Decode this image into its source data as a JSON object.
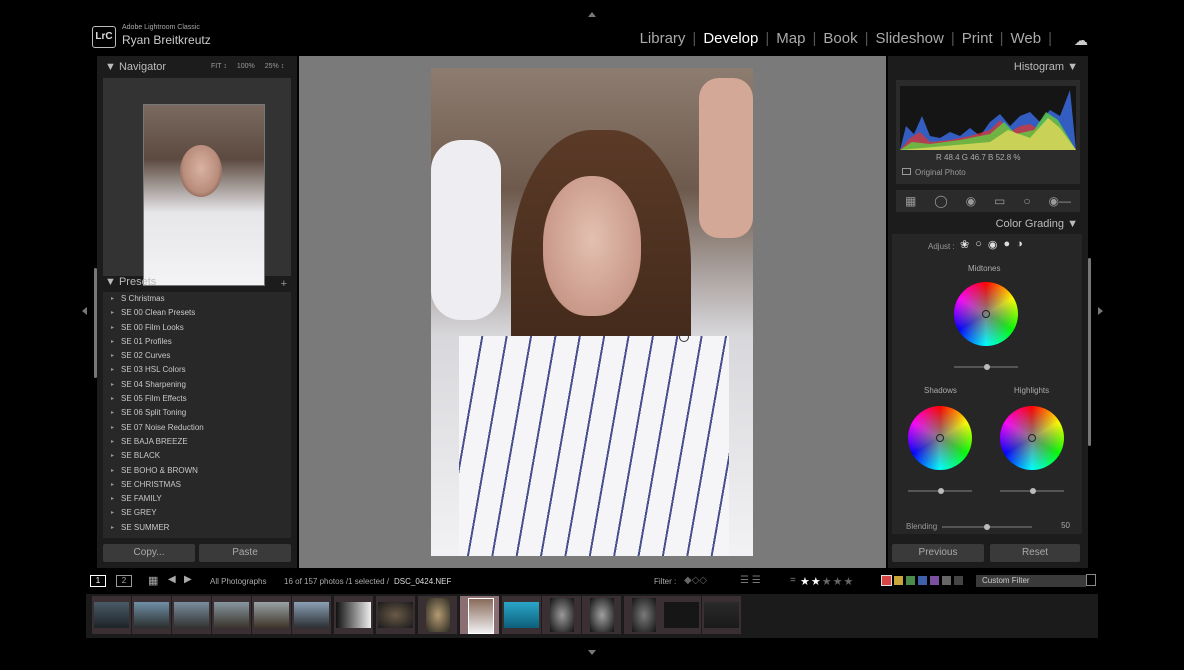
{
  "app": {
    "name": "Adobe Lightroom Classic",
    "logo": "LrC",
    "user": "Ryan Breitkreutz"
  },
  "modules": [
    "Library",
    "Develop",
    "Map",
    "Book",
    "Slideshow",
    "Print",
    "Web"
  ],
  "active_module": "Develop",
  "navigator": {
    "title": "Navigator",
    "options": [
      "FIT ↕",
      "100%",
      "25% ↕"
    ]
  },
  "presets": {
    "title": "Presets",
    "items": [
      "S Christmas",
      "SE 00 Clean Presets",
      "SE 00 Film Looks",
      "SE 01 Profiles",
      "SE 02 Curves",
      "SE 03 HSL Colors",
      "SE 04 Sharpening",
      "SE 05 Film Effects",
      "SE 06 Split Toning",
      "SE 07 Noise Reduction",
      "SE BAJA BREEZE",
      "SE BLACK",
      "SE BOHO & BROWN",
      "SE CHRISTMAS",
      "SE FAMILY",
      "SE GREY",
      "SE SUMMER"
    ]
  },
  "left_buttons": {
    "copy": "Copy...",
    "paste": "Paste"
  },
  "histogram": {
    "title": "Histogram",
    "values": "R 48.4  G 46.7  B 52.8 %",
    "original_photo": "Original Photo"
  },
  "color_grading": {
    "title": "Color Grading",
    "adjust_label": "Adjust :",
    "midtones": "Midtones",
    "shadows": "Shadows",
    "highlights": "Highlights",
    "blending_label": "Blending",
    "blending_value": "50"
  },
  "right_buttons": {
    "previous": "Previous",
    "reset": "Reset"
  },
  "filmbar": {
    "view1": "1",
    "view2": "2",
    "source": "All Photographs",
    "count": "16 of 157 photos /1 selected /",
    "filename": "DSC_0424.NEF",
    "filter_label": "Filter :",
    "rating": 2,
    "custom_filter": "Custom Filter"
  },
  "colors": {
    "panel_bg": "#1c1c1c",
    "center_bg": "#7a7a7a",
    "active_text": "#ffffff",
    "label_swatches": [
      "#d94444",
      "#caa63a",
      "#4d8b4d",
      "#3f5fa8",
      "#7a4fa0",
      "#666666",
      "#444444"
    ]
  }
}
